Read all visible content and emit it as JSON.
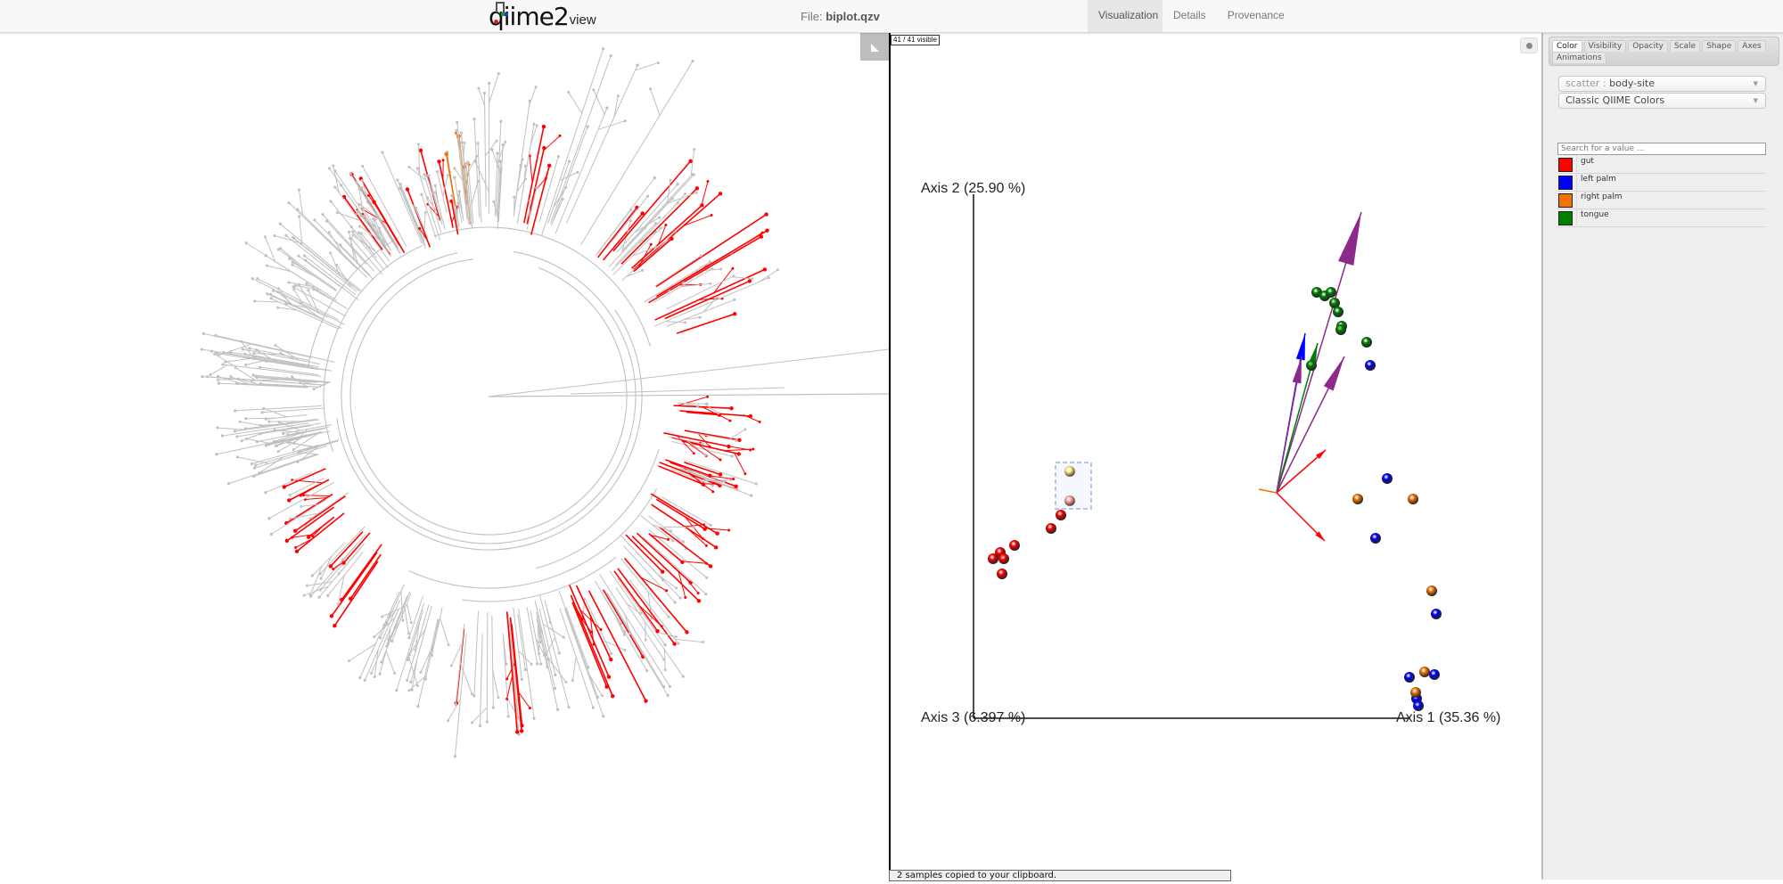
{
  "app": {
    "logo_text": "qiime2",
    "logo_sub": "view",
    "file_prefix": "File:",
    "file_name": "biplot.qzv"
  },
  "nav_tabs": [
    {
      "label": "Visualization",
      "active": true
    },
    {
      "label": "Details",
      "active": false
    },
    {
      "label": "Provenance",
      "active": false
    }
  ],
  "scatter": {
    "visible_count": "41 / 41 visible",
    "axis1_label": "Axis 1 (35.36 %)",
    "axis2_label": "Axis 2 (25.90 %)",
    "axis3_label": "Axis 3 (6.397 %)",
    "status_message": "2 samples copied to your clipboard."
  },
  "menu": {
    "tabs": [
      {
        "label": "Color",
        "active": true
      },
      {
        "label": "Visibility",
        "active": false
      },
      {
        "label": "Opacity",
        "active": false
      },
      {
        "label": "Scale",
        "active": false
      },
      {
        "label": "Shape",
        "active": false
      },
      {
        "label": "Axes",
        "active": false
      },
      {
        "label": "Animations",
        "active": false
      }
    ],
    "category_prefix": "scatter :",
    "category_value": "body-site",
    "colormap": "Classic QIIME Colors",
    "search_placeholder": "Search for a value ...",
    "legend": [
      {
        "label": "gut",
        "color": "#ff0000"
      },
      {
        "label": "left palm",
        "color": "#0000ff"
      },
      {
        "label": "right palm",
        "color": "#f27304"
      },
      {
        "label": "tongue",
        "color": "#008000"
      }
    ]
  },
  "colors": {
    "gut": "#ff0000",
    "left_palm": "#0000ff",
    "right_palm": "#f27304",
    "tongue": "#008000",
    "arrow_purple": "#8b2a8b",
    "tree_gray": "#c0c0c0"
  }
}
